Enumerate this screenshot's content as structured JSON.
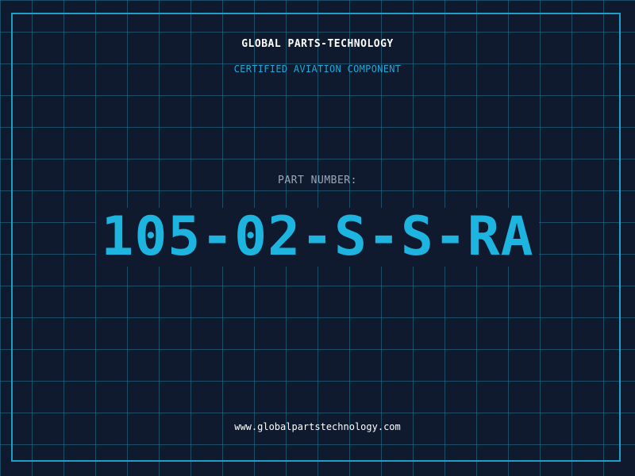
{
  "header": {
    "company": "GLOBAL PARTS-TECHNOLOGY",
    "subtitle": "CERTIFIED AVIATION COMPONENT"
  },
  "part": {
    "label": "PART NUMBER:",
    "number": "105-02-S-S-RA"
  },
  "footer": {
    "url": "www.globalpartstechnology.com"
  },
  "colors": {
    "background": "#0f1a2e",
    "accent": "#1eb4e0",
    "grid": "#28789a",
    "frame": "#1b9fc8"
  }
}
